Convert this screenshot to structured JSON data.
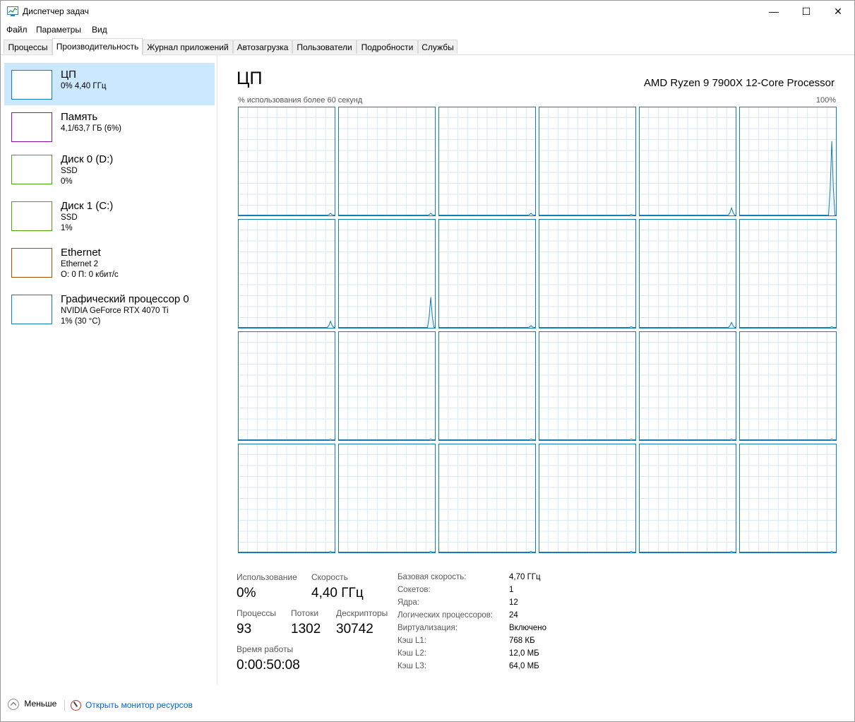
{
  "window": {
    "title": "Диспетчер задач",
    "minimize": "—",
    "maximize": "☐",
    "close": "✕"
  },
  "menu": [
    {
      "label": "Файл"
    },
    {
      "label": "Параметры"
    },
    {
      "label": "Вид"
    }
  ],
  "tabs": [
    {
      "label": "Процессы"
    },
    {
      "label": "Производительность",
      "active": true
    },
    {
      "label": "Журнал приложений"
    },
    {
      "label": "Автозагрузка"
    },
    {
      "label": "Пользователи"
    },
    {
      "label": "Подробности"
    },
    {
      "label": "Службы"
    }
  ],
  "resources": [
    {
      "name": "ЦП",
      "lines": [
        "0% 4,40 ГГц"
      ],
      "color": "#117dbb",
      "selected": true
    },
    {
      "name": "Память",
      "lines": [
        "4,1/63,7 ГБ (6%)"
      ],
      "color": "#8b12ae"
    },
    {
      "name": "Диск 0 (D:)",
      "lines": [
        "SSD",
        "0%"
      ],
      "color": "#4da60c"
    },
    {
      "name": "Диск 1 (C:)",
      "lines": [
        "SSD",
        "1%"
      ],
      "color": "#4da60c"
    },
    {
      "name": "Ethernet",
      "lines": [
        "Ethernet 2",
        "О: 0 П: 0 кбит/с"
      ],
      "color": "#a74f01"
    },
    {
      "name": "Графический процессор 0",
      "lines": [
        "NVIDIA GeForce RTX 4070 Ti",
        "1% (30 °C)"
      ],
      "color": "#117dbb"
    }
  ],
  "main": {
    "title": "ЦП",
    "processor": "AMD Ryzen 9 7900X 12-Core Processor",
    "axis_left": "% использования более 60 секунд",
    "axis_right": "100%"
  },
  "chart_data": {
    "type": "line",
    "description_units": "percent utilization per logical processor over last 60 seconds",
    "ylim": [
      0,
      100
    ],
    "cores": [
      {
        "peak": 2
      },
      {
        "peak": 2
      },
      {
        "peak": 2
      },
      {
        "peak": 1
      },
      {
        "peak": 7
      },
      {
        "peak": 68
      },
      {
        "peak": 6
      },
      {
        "peak": 28
      },
      {
        "peak": 2
      },
      {
        "peak": 1
      },
      {
        "peak": 5
      },
      {
        "peak": 1
      },
      {
        "peak": 1
      },
      {
        "peak": 1
      },
      {
        "peak": 1
      },
      {
        "peak": 1
      },
      {
        "peak": 1
      },
      {
        "peak": 1
      },
      {
        "peak": 1
      },
      {
        "peak": 1
      },
      {
        "peak": 1
      },
      {
        "peak": 1
      },
      {
        "peak": 1
      },
      {
        "peak": 1
      }
    ],
    "color": "#117dbb"
  },
  "stats": {
    "usage_label": "Использование",
    "usage_value": "0%",
    "speed_label": "Скорость",
    "speed_value": "4,40 ГГц",
    "processes_label": "Процессы",
    "processes_value": "93",
    "threads_label": "Потоки",
    "threads_value": "1302",
    "handles_label": "Дескрипторы",
    "handles_value": "30742",
    "uptime_label": "Время работы",
    "uptime_value": "0:00:50:08"
  },
  "info": [
    {
      "label": "Базовая скорость:",
      "value": "4,70 ГГц"
    },
    {
      "label": "Сокетов:",
      "value": "1"
    },
    {
      "label": "Ядра:",
      "value": "12"
    },
    {
      "label": "Логических процессоров:",
      "value": "24"
    },
    {
      "label": "Виртуализация:",
      "value": "Включено"
    },
    {
      "label": "Кэш L1:",
      "value": "768 КБ"
    },
    {
      "label": "Кэш L2:",
      "value": "12,0 МБ"
    },
    {
      "label": "Кэш L3:",
      "value": "64,0 МБ"
    }
  ],
  "footer": {
    "less": "Меньше",
    "resource_monitor": "Открыть монитор ресурсов"
  }
}
